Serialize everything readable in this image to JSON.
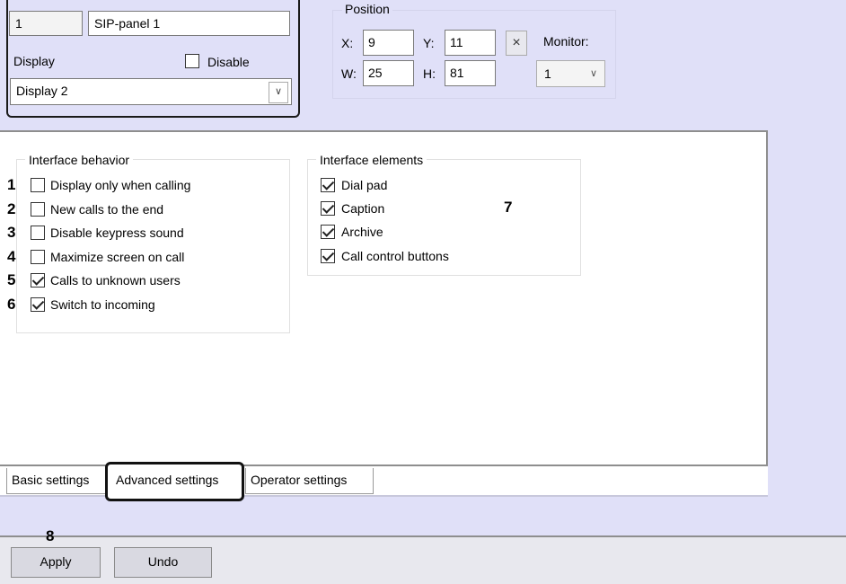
{
  "top": {
    "id_value": "1",
    "name_value": "SIP-panel 1",
    "display_label": "Display",
    "disable_label": "Disable",
    "disable_checked": false,
    "display_value": "Display 2"
  },
  "position": {
    "title": "Position",
    "x_label": "X:",
    "x_value": "9",
    "y_label": "Y:",
    "y_value": "11",
    "w_label": "W:",
    "w_value": "25",
    "h_label": "H:",
    "h_value": "81",
    "clear_symbol": "×",
    "monitor_label": "Monitor:",
    "monitor_value": "1"
  },
  "behavior": {
    "title": "Interface behavior",
    "options": [
      {
        "num": "1",
        "label": "Display only when calling",
        "checked": false
      },
      {
        "num": "2",
        "label": "New calls to the end",
        "checked": false
      },
      {
        "num": "3",
        "label": "Disable keypress sound",
        "checked": false
      },
      {
        "num": "4",
        "label": "Maximize screen on call",
        "checked": false
      },
      {
        "num": "5",
        "label": "Calls to unknown users",
        "checked": true
      },
      {
        "num": "6",
        "label": "Switch to incoming",
        "checked": true
      }
    ]
  },
  "elements": {
    "title": "Interface elements",
    "marker": "7",
    "options": [
      {
        "label": "Dial pad",
        "checked": true
      },
      {
        "label": "Caption",
        "checked": true
      },
      {
        "label": "Archive",
        "checked": true
      },
      {
        "label": "Call control buttons",
        "checked": true
      }
    ]
  },
  "tabs": {
    "basic": "Basic settings",
    "advanced": "Advanced settings",
    "operator": "Operator settings",
    "active": "advanced"
  },
  "footer": {
    "marker": "8",
    "apply_label": "Apply",
    "undo_label": "Undo"
  }
}
